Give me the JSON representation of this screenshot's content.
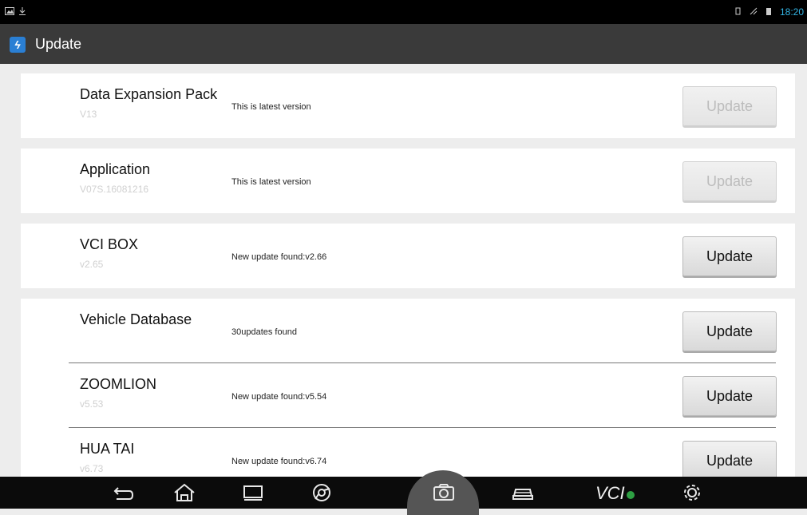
{
  "statusbar": {
    "time": "18:20"
  },
  "appbar": {
    "title": "Update"
  },
  "items": [
    {
      "name": "Data Expansion Pack",
      "version": "V13",
      "status": "This is latest version",
      "button": "Update",
      "enabled": false
    },
    {
      "name": "Application",
      "version": "V07S.16081216",
      "status": "This is latest version",
      "button": "Update",
      "enabled": false
    },
    {
      "name": "VCI BOX",
      "version": "v2.65",
      "status": "New update found:v2.66",
      "button": "Update",
      "enabled": true
    },
    {
      "name": "Vehicle Database",
      "version": "",
      "status": "30updates found",
      "button": "Update",
      "enabled": true
    },
    {
      "name": "ZOOMLION",
      "version": "v5.53",
      "status": "New update found:v5.54",
      "button": "Update",
      "enabled": true
    },
    {
      "name": "HUA TAI",
      "version": "v6.73",
      "status": "New update found:v6.74",
      "button": "Update",
      "enabled": true
    }
  ],
  "navbar": {
    "vci_label": "VCI"
  }
}
